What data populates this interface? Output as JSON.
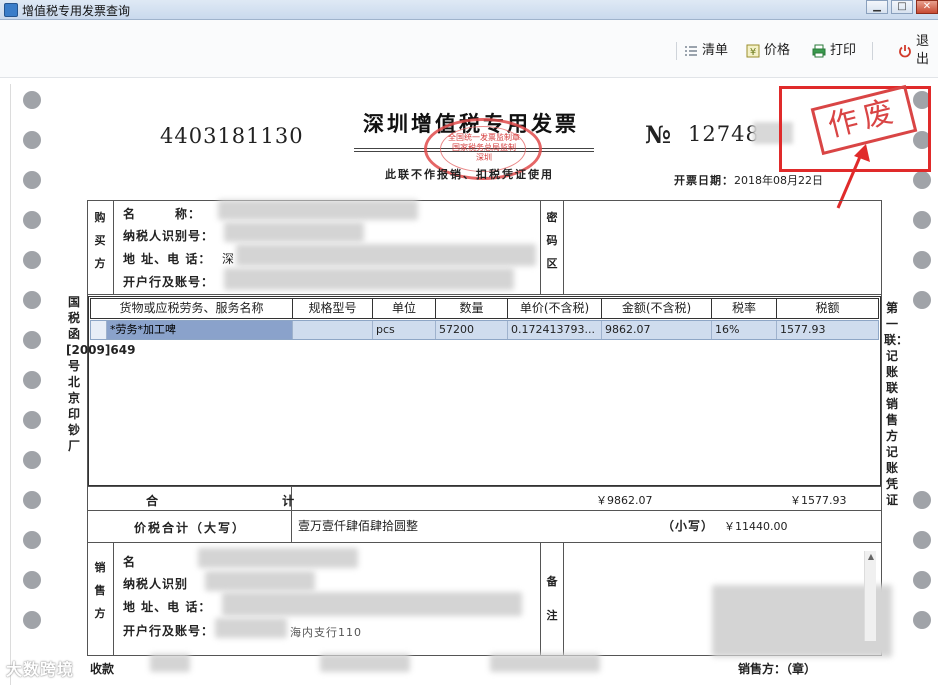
{
  "window": {
    "title": "增值税专用发票查询",
    "controls": {
      "minimize": "▁",
      "maximize": "□",
      "close": "✕"
    }
  },
  "toolbar": {
    "clear": "清单",
    "price": "价格",
    "print": "打印",
    "exit": "退出"
  },
  "invoice": {
    "title": "深圳增值税专用发票",
    "subtitle": "此联不作报销、扣税凭证使用",
    "code": "4403181130",
    "number_mark": "№",
    "number": "12748",
    "issue_date_label": "开票日期：",
    "issue_date": "2018年08月22日",
    "seal_text": "全国统一发票监制章 国家税务总局监制 深圳",
    "void_stamp": "作废",
    "buyer": {
      "section": [
        "购",
        "买",
        "方"
      ],
      "name_label": "名　　　称：",
      "tax_id_label": "纳税人识别号：",
      "address_label": "地 址、电 话：",
      "bank_label": "开户行及账号：",
      "address_prefix": "深"
    },
    "cipher": {
      "section": [
        "密",
        "码",
        "区"
      ]
    },
    "items_header": [
      "货物或应税劳务、服务名称",
      "规格型号",
      "单位",
      "数量",
      "单价(不含税)",
      "金额(不含税)",
      "税率",
      "税额"
    ],
    "items": [
      {
        "name": "*劳务*加工啤",
        "spec": "",
        "unit": "pcs",
        "qty": "57200",
        "price": "0.172413793...",
        "amount": "9862.07",
        "rate": "16%",
        "tax": "1577.93"
      }
    ],
    "total_label": "合 计",
    "total_amount": "￥9862.07",
    "total_tax": "￥1577.93",
    "price_tax_label": "价税合计（大写）",
    "price_tax_upper": "壹万壹仟肆佰肆拾圆整",
    "price_tax_lower_label": "（小写）",
    "price_tax_lower": "￥11440.00",
    "seller": {
      "section": [
        "销",
        "售",
        "方"
      ],
      "name_label": "名",
      "tax_id_label": "纳税人识别",
      "address_label": "地 址、电 话：",
      "bank_label": "开户行及账号：",
      "bank_partial": "海内支行110"
    },
    "remarks": {
      "section": [
        "备",
        "注"
      ]
    },
    "left_side_text": "国税函[2009]649号北京印钞厂",
    "right_side_text": "第一联：记账联 销售方记账凭证",
    "bottom_left": "收款",
    "bottom_right": "销售方：（章）"
  },
  "watermark": "大数跨境",
  "colors": {
    "void_red": "#e02a2a",
    "seal_red": "#e04b4b",
    "selected_row": "#cfdcee"
  }
}
